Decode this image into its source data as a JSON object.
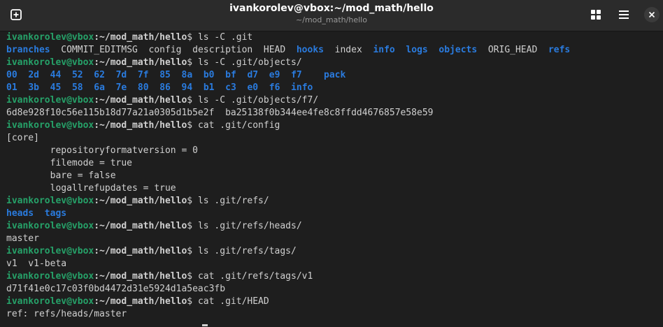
{
  "window": {
    "title": "ivankorolev@vbox:~/mod_math/hello",
    "subtitle": "~/mod_math/hello"
  },
  "icons": {
    "new_tab": "new-tab-icon",
    "grid": "grid-view-icon",
    "menu": "hamburger-menu-icon",
    "close": "close-icon"
  },
  "colors": {
    "background": "#1e1e1e",
    "titlebar": "#2b2b2b",
    "prompt_user": "#26a269",
    "directory": "#2a7bde",
    "text": "#d0d0d0"
  },
  "prompt": {
    "user_host": "ivankorolev@vbox",
    "path": ":~/mod_math/hello",
    "symbol": "$ "
  },
  "lines": [
    {
      "type": "prompt",
      "cmd": "ls -C .git"
    },
    {
      "type": "out",
      "spans": [
        {
          "t": "branches",
          "c": "dir"
        },
        {
          "t": "  "
        },
        {
          "t": "COMMIT_EDITMSG"
        },
        {
          "t": "  "
        },
        {
          "t": "config"
        },
        {
          "t": "  "
        },
        {
          "t": "description"
        },
        {
          "t": "  "
        },
        {
          "t": "HEAD"
        },
        {
          "t": "  "
        },
        {
          "t": "hooks",
          "c": "dir"
        },
        {
          "t": "  "
        },
        {
          "t": "index"
        },
        {
          "t": "  "
        },
        {
          "t": "info",
          "c": "dir"
        },
        {
          "t": "  "
        },
        {
          "t": "logs",
          "c": "dir"
        },
        {
          "t": "  "
        },
        {
          "t": "objects",
          "c": "dir"
        },
        {
          "t": "  "
        },
        {
          "t": "ORIG_HEAD"
        },
        {
          "t": "  "
        },
        {
          "t": "refs",
          "c": "dir"
        }
      ]
    },
    {
      "type": "prompt",
      "cmd": "ls -C .git/objects/"
    },
    {
      "type": "out",
      "spans": [
        {
          "t": "00",
          "c": "dir"
        },
        {
          "t": "  "
        },
        {
          "t": "2d",
          "c": "dir"
        },
        {
          "t": "  "
        },
        {
          "t": "44",
          "c": "dir"
        },
        {
          "t": "  "
        },
        {
          "t": "52",
          "c": "dir"
        },
        {
          "t": "  "
        },
        {
          "t": "62",
          "c": "dir"
        },
        {
          "t": "  "
        },
        {
          "t": "7d",
          "c": "dir"
        },
        {
          "t": "  "
        },
        {
          "t": "7f",
          "c": "dir"
        },
        {
          "t": "  "
        },
        {
          "t": "85",
          "c": "dir"
        },
        {
          "t": "  "
        },
        {
          "t": "8a",
          "c": "dir"
        },
        {
          "t": "  "
        },
        {
          "t": "b0",
          "c": "dir"
        },
        {
          "t": "  "
        },
        {
          "t": "bf",
          "c": "dir"
        },
        {
          "t": "  "
        },
        {
          "t": "d7",
          "c": "dir"
        },
        {
          "t": "  "
        },
        {
          "t": "e9",
          "c": "dir"
        },
        {
          "t": "  "
        },
        {
          "t": "f7",
          "c": "dir"
        },
        {
          "t": "    "
        },
        {
          "t": "pack",
          "c": "dir"
        }
      ]
    },
    {
      "type": "out",
      "spans": [
        {
          "t": "01",
          "c": "dir"
        },
        {
          "t": "  "
        },
        {
          "t": "3b",
          "c": "dir"
        },
        {
          "t": "  "
        },
        {
          "t": "45",
          "c": "dir"
        },
        {
          "t": "  "
        },
        {
          "t": "58",
          "c": "dir"
        },
        {
          "t": "  "
        },
        {
          "t": "6a",
          "c": "dir"
        },
        {
          "t": "  "
        },
        {
          "t": "7e",
          "c": "dir"
        },
        {
          "t": "  "
        },
        {
          "t": "80",
          "c": "dir"
        },
        {
          "t": "  "
        },
        {
          "t": "86",
          "c": "dir"
        },
        {
          "t": "  "
        },
        {
          "t": "94",
          "c": "dir"
        },
        {
          "t": "  "
        },
        {
          "t": "b1",
          "c": "dir"
        },
        {
          "t": "  "
        },
        {
          "t": "c3",
          "c": "dir"
        },
        {
          "t": "  "
        },
        {
          "t": "e0",
          "c": "dir"
        },
        {
          "t": "  "
        },
        {
          "t": "f6",
          "c": "dir"
        },
        {
          "t": "  "
        },
        {
          "t": "info",
          "c": "dir"
        }
      ]
    },
    {
      "type": "prompt",
      "cmd": "ls -C .git/objects/f7/"
    },
    {
      "type": "out",
      "spans": [
        {
          "t": "6d8e928f10c56e115b18d77a21a0305d1b5e2f  ba25138f0b344ee4fe8c8ffdd4676857e58e59"
        }
      ]
    },
    {
      "type": "prompt",
      "cmd": "cat .git/config"
    },
    {
      "type": "out",
      "spans": [
        {
          "t": "[core]"
        }
      ]
    },
    {
      "type": "out",
      "spans": [
        {
          "t": "        repositoryformatversion = 0"
        }
      ]
    },
    {
      "type": "out",
      "spans": [
        {
          "t": "        filemode = true"
        }
      ]
    },
    {
      "type": "out",
      "spans": [
        {
          "t": "        bare = false"
        }
      ]
    },
    {
      "type": "out",
      "spans": [
        {
          "t": "        logallrefupdates = true"
        }
      ]
    },
    {
      "type": "prompt",
      "cmd": "ls .git/refs/"
    },
    {
      "type": "out",
      "spans": [
        {
          "t": "heads",
          "c": "dir"
        },
        {
          "t": "  "
        },
        {
          "t": "tags",
          "c": "dir"
        }
      ]
    },
    {
      "type": "prompt",
      "cmd": "ls .git/refs/heads/"
    },
    {
      "type": "out",
      "spans": [
        {
          "t": "master"
        }
      ]
    },
    {
      "type": "prompt",
      "cmd": "ls .git/refs/tags/"
    },
    {
      "type": "out",
      "spans": [
        {
          "t": "v1  v1-beta"
        }
      ]
    },
    {
      "type": "prompt",
      "cmd": "cat .git/refs/tags/v1"
    },
    {
      "type": "out",
      "spans": [
        {
          "t": "d71f41e0c17c03f0bd4472d31e5924d1a5eac3fb"
        }
      ]
    },
    {
      "type": "prompt",
      "cmd": "cat .git/HEAD"
    },
    {
      "type": "out",
      "spans": [
        {
          "t": "ref: refs/heads/master"
        }
      ]
    }
  ]
}
